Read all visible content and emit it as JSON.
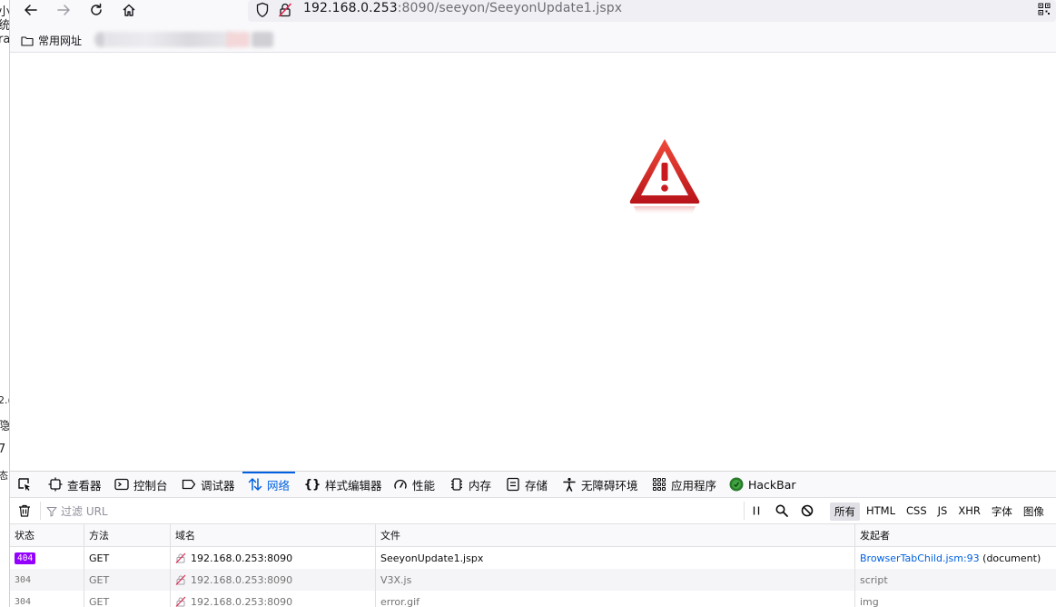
{
  "browser": {
    "url_host": "192.168.0.253",
    "url_rest": ":8090/seeyon/SeeyonUpdate1.jspx",
    "bookmark_label": "常用网址"
  },
  "edge_fragments": [
    "小",
    "统",
    "ra",
    "2.(",
    "隐",
    "7",
    "态"
  ],
  "devtools": {
    "tabs": [
      {
        "label": "查看器",
        "icon": "inspector-icon"
      },
      {
        "label": "控制台",
        "icon": "console-icon"
      },
      {
        "label": "调试器",
        "icon": "debugger-icon"
      },
      {
        "label": "网络",
        "icon": "network-icon"
      },
      {
        "label": "样式编辑器",
        "icon": "style-editor-icon"
      },
      {
        "label": "性能",
        "icon": "performance-icon"
      },
      {
        "label": "内存",
        "icon": "memory-icon"
      },
      {
        "label": "存储",
        "icon": "storage-icon"
      },
      {
        "label": "无障碍环境",
        "icon": "accessibility-icon"
      },
      {
        "label": "应用程序",
        "icon": "application-icon"
      },
      {
        "label": "HackBar",
        "icon": "hackbar-icon"
      }
    ],
    "active_tab": "网络",
    "filter_placeholder": "过滤 URL",
    "type_filters": [
      "所有",
      "HTML",
      "CSS",
      "JS",
      "XHR",
      "字体",
      "图像"
    ],
    "selected_type_filter": "所有",
    "columns": [
      "状态",
      "方法",
      "域名",
      "文件",
      "发起者"
    ],
    "requests": [
      {
        "status": "404",
        "method": "GET",
        "domain": "192.168.0.253:8090",
        "file": "SeeyonUpdate1.jspx",
        "initiator_link": "BrowserTabChild.jsm:93",
        "initiator_extra": " (document)"
      },
      {
        "status": "304",
        "method": "GET",
        "domain": "192.168.0.253:8090",
        "file": "V3X.js",
        "initiator_link": "",
        "initiator_extra": "script"
      },
      {
        "status": "304",
        "method": "GET",
        "domain": "192.168.0.253:8090",
        "file": "error.gif",
        "initiator_link": "",
        "initiator_extra": "img"
      }
    ]
  },
  "colors": {
    "accent": "#0060df",
    "status_404": "#9400ff",
    "warning_red": "#d42020"
  }
}
